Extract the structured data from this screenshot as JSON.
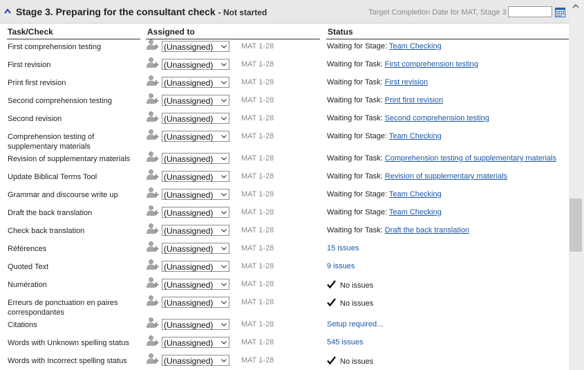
{
  "stage": {
    "title": "Stage 3. Preparing for the consultant check",
    "status": "- Not started",
    "target_label": "Target Completion Date for MAT, Stage 3",
    "target_value": ""
  },
  "columns": {
    "task": "Task/Check",
    "assigned": "Assigned to",
    "status": "Status"
  },
  "colors": {
    "link": "#1a55a6",
    "header_bg": "#e8e8e8",
    "muted": "#8a8a8a"
  },
  "rows": [
    {
      "name": "First comprehension testing",
      "assigned": "(Unassigned)",
      "range": "MAT 1-28",
      "status_prefix": "Waiting for Stage:",
      "status_link": "Team Checking"
    },
    {
      "name": "First revision",
      "assigned": "(Unassigned)",
      "range": "MAT 1-28",
      "status_prefix": "Waiting for Task:",
      "status_link": "First comprehension testing"
    },
    {
      "name": "Print first revision",
      "assigned": "(Unassigned)",
      "range": "MAT 1-28",
      "status_prefix": "Waiting for Task:",
      "status_link": "First revision"
    },
    {
      "name": "Second comprehension testing",
      "assigned": "(Unassigned)",
      "range": "MAT 1-28",
      "status_prefix": "Waiting for Task:",
      "status_link": "Print first revision"
    },
    {
      "name": "Second revision",
      "assigned": "(Unassigned)",
      "range": "MAT 1-28",
      "status_prefix": "Waiting for Task:",
      "status_link": "Second comprehension testing"
    },
    {
      "name": "Comprehension testing of supplementary materials",
      "assigned": "(Unassigned)",
      "range": "MAT 1-28",
      "status_prefix": "Waiting for Stage:",
      "status_link": "Team Checking"
    },
    {
      "name": "Revision of supplementary materials",
      "assigned": "(Unassigned)",
      "range": "MAT 1-28",
      "status_prefix": "Waiting for Task:",
      "status_link": "Comprehension testing of supplementary materials"
    },
    {
      "name": "Update Biblical Terms Tool",
      "assigned": "(Unassigned)",
      "range": "MAT 1-28",
      "status_prefix": "Waiting for Task:",
      "status_link": "Revision of supplementary materials"
    },
    {
      "name": "Grammar and discourse write up",
      "assigned": "(Unassigned)",
      "range": "MAT 1-28",
      "status_prefix": "Waiting for Stage:",
      "status_link": "Team Checking"
    },
    {
      "name": "Draft the back translation",
      "assigned": "(Unassigned)",
      "range": "MAT 1-28",
      "status_prefix": "Waiting for Stage:",
      "status_link": "Team Checking"
    },
    {
      "name": "Check back translation",
      "assigned": "(Unassigned)",
      "range": "MAT 1-28",
      "status_prefix": "Waiting for Task:",
      "status_link": "Draft the back translation"
    },
    {
      "name": "Références",
      "assigned": "(Unassigned)",
      "range": "MAT 1-28",
      "status_issues": "15 issues"
    },
    {
      "name": "Quoted Text",
      "assigned": "(Unassigned)",
      "range": "MAT 1-28",
      "status_issues": "9 issues"
    },
    {
      "name": "Numération",
      "assigned": "(Unassigned)",
      "range": "MAT 1-28",
      "status_ok": "No issues"
    },
    {
      "name": "Erreurs de ponctuation en paires correspondantes",
      "assigned": "(Unassigned)",
      "range": "MAT 1-28",
      "status_ok": "No issues"
    },
    {
      "name": "Citations",
      "assigned": "(Unassigned)",
      "range": "MAT 1-28",
      "status_issues": "Setup required..."
    },
    {
      "name": "Words with Unknown spelling status",
      "assigned": "(Unassigned)",
      "range": "MAT 1-28",
      "status_issues": "545 issues"
    },
    {
      "name": "Words with Incorrect spelling status",
      "assigned": "(Unassigned)",
      "range": "MAT 1-28",
      "status_ok": "No issues"
    }
  ]
}
